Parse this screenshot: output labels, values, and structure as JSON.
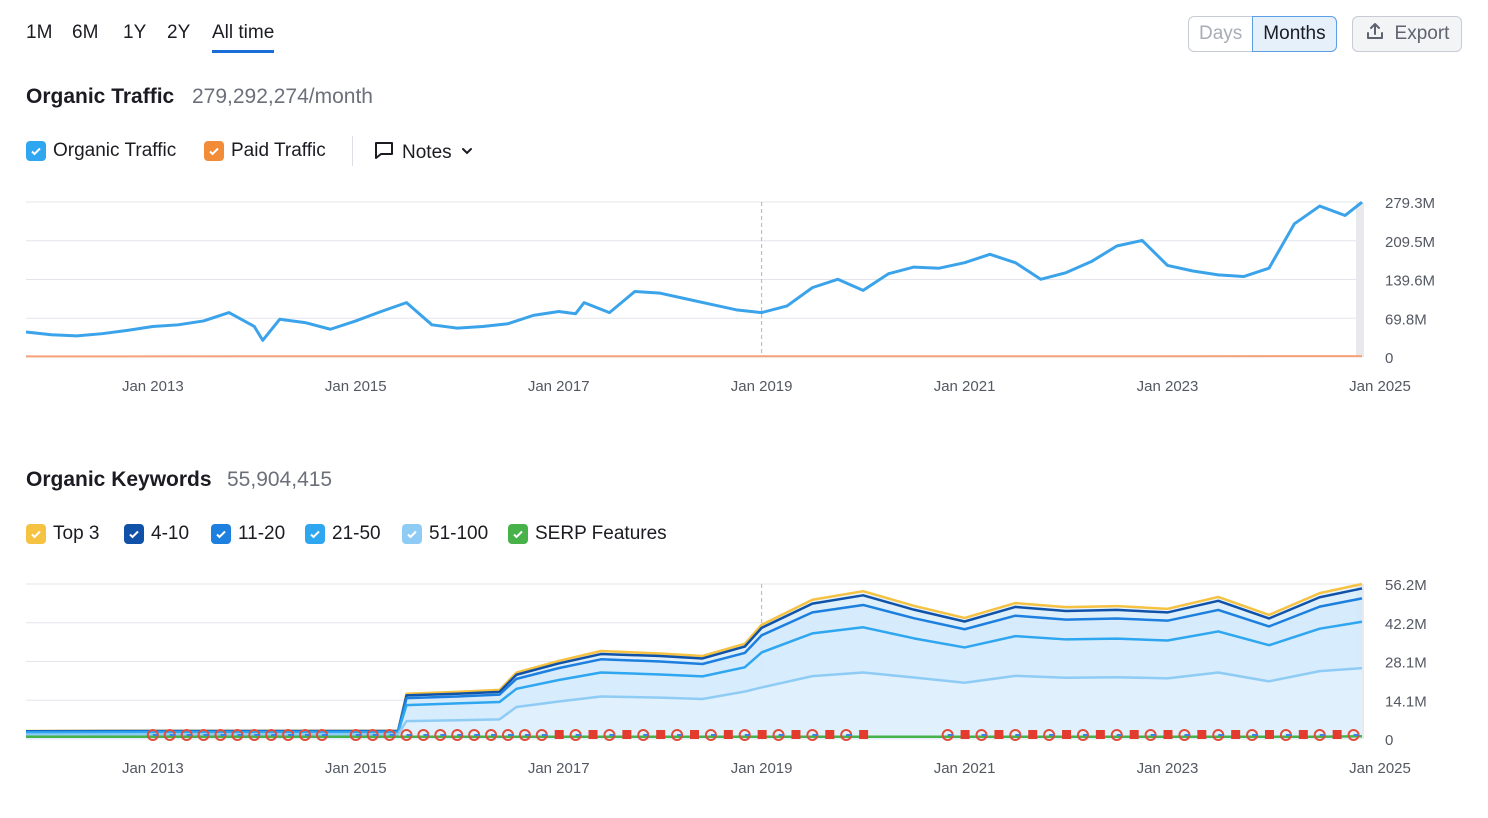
{
  "range_tabs": [
    "1M",
    "6M",
    "1Y",
    "2Y",
    "All time"
  ],
  "active_range": "All time",
  "granularity": {
    "days": "Days",
    "months": "Months",
    "selected": "Months"
  },
  "export_label": "Export",
  "traffic": {
    "title": "Organic Traffic",
    "value": "279,292,274/month",
    "legend": [
      {
        "label": "Organic Traffic",
        "color": "#2ea6f0",
        "checked": true
      },
      {
        "label": "Paid Traffic",
        "color": "#f28c38",
        "checked": true
      }
    ],
    "notes_label": "Notes"
  },
  "keywords": {
    "title": "Organic Keywords",
    "value": "55,904,415",
    "legend": [
      {
        "label": "Top 3",
        "color": "#f5c242",
        "checked": true
      },
      {
        "label": "4-10",
        "color": "#0f52a8",
        "checked": true
      },
      {
        "label": "11-20",
        "color": "#1d7fde",
        "checked": true
      },
      {
        "label": "21-50",
        "color": "#2ea6f0",
        "checked": true
      },
      {
        "label": "51-100",
        "color": "#8fccf5",
        "checked": true
      },
      {
        "label": "SERP Features",
        "color": "#47b24a",
        "checked": true
      }
    ]
  },
  "chart_data": [
    {
      "type": "line",
      "title": "Organic Traffic",
      "x_tick_labels": [
        "Jan 2013",
        "Jan 2015",
        "Jan 2017",
        "Jan 2019",
        "Jan 2021",
        "Jan 2023",
        "Jan 2025"
      ],
      "y_tick_labels": [
        "0",
        "69.8M",
        "139.6M",
        "209.5M",
        "279.3M"
      ],
      "ylim": [
        0,
        279.3
      ],
      "y_unit": "M",
      "x_range": [
        "2011-10",
        "2024-12"
      ],
      "series": [
        {
          "name": "Organic Traffic",
          "color": "#3ba3ea",
          "x": [
            "2011-10",
            "2012-01",
            "2012-04",
            "2012-07",
            "2012-10",
            "2013-01",
            "2013-04",
            "2013-07",
            "2013-10",
            "2014-01",
            "2014-02",
            "2014-04",
            "2014-07",
            "2014-10",
            "2015-01",
            "2015-04",
            "2015-07",
            "2015-10",
            "2016-01",
            "2016-04",
            "2016-07",
            "2016-10",
            "2017-01",
            "2017-03",
            "2017-04",
            "2017-07",
            "2017-10",
            "2018-01",
            "2018-04",
            "2018-07",
            "2018-10",
            "2019-01",
            "2019-04",
            "2019-07",
            "2019-10",
            "2020-01",
            "2020-04",
            "2020-07",
            "2020-10",
            "2021-01",
            "2021-04",
            "2021-07",
            "2021-10",
            "2022-01",
            "2022-04",
            "2022-07",
            "2022-10",
            "2023-01",
            "2023-04",
            "2023-07",
            "2023-10",
            "2024-01",
            "2024-04",
            "2024-07",
            "2024-10",
            "2024-12"
          ],
          "values": [
            45,
            40,
            38,
            42,
            48,
            55,
            58,
            65,
            80,
            55,
            30,
            68,
            62,
            50,
            65,
            82,
            98,
            58,
            52,
            55,
            60,
            75,
            82,
            78,
            98,
            80,
            118,
            115,
            105,
            95,
            85,
            80,
            92,
            125,
            140,
            120,
            150,
            162,
            160,
            170,
            185,
            170,
            140,
            152,
            172,
            200,
            210,
            165,
            155,
            148,
            145,
            160,
            240,
            272,
            255,
            279
          ]
        },
        {
          "name": "Paid Traffic",
          "color": "#f5a27a",
          "x": [
            "2011-10",
            "2024-12"
          ],
          "values": [
            1.2,
            1.5
          ]
        }
      ]
    },
    {
      "type": "area",
      "title": "Organic Keywords",
      "x_tick_labels": [
        "Jan 2013",
        "Jan 2015",
        "Jan 2017",
        "Jan 2019",
        "Jan 2021",
        "Jan 2023",
        "Jan 2025"
      ],
      "y_tick_labels": [
        "0",
        "14.1M",
        "28.1M",
        "42.2M",
        "56.2M"
      ],
      "ylim": [
        0,
        56.2
      ],
      "y_unit": "M",
      "stacked": true,
      "x": [
        "2011-10",
        "2013-01",
        "2014-01",
        "2015-06",
        "2015-07",
        "2016-01",
        "2016-06",
        "2016-08",
        "2017-01",
        "2017-06",
        "2018-01",
        "2018-06",
        "2018-11",
        "2019-01",
        "2019-07",
        "2020-01",
        "2020-07",
        "2021-01",
        "2021-07",
        "2022-01",
        "2022-07",
        "2023-01",
        "2023-07",
        "2024-01",
        "2024-07",
        "2024-12"
      ],
      "series": [
        {
          "name": "Top 3",
          "color": "#f5c242",
          "values": [
            2.9,
            3.0,
            3.0,
            3.0,
            16.4,
            17.1,
            17.8,
            24.1,
            28.3,
            31.9,
            31.0,
            30.1,
            34.5,
            41.4,
            50.5,
            53.6,
            48.3,
            43.9,
            49.3,
            47.8,
            48.2,
            47.2,
            51.5,
            45.0,
            52.9,
            56.2
          ]
        },
        {
          "name": "4-10",
          "color": "#0f52a8",
          "values": [
            2.8,
            2.9,
            2.9,
            2.9,
            15.8,
            16.4,
            17.1,
            23.3,
            27.4,
            30.8,
            30.1,
            29.2,
            33.5,
            40.3,
            49.1,
            52.1,
            46.9,
            42.6,
            47.9,
            46.4,
            46.8,
            45.9,
            50.1,
            43.7,
            51.4,
            54.6
          ]
        },
        {
          "name": "11-20",
          "color": "#1d7fde",
          "values": [
            2.6,
            2.7,
            2.7,
            2.7,
            14.8,
            15.4,
            16.1,
            21.8,
            25.7,
            28.9,
            28.1,
            27.2,
            31.2,
            37.6,
            45.9,
            48.6,
            43.8,
            39.8,
            44.7,
            43.3,
            43.7,
            42.9,
            46.8,
            40.8,
            48.0,
            51.0
          ]
        },
        {
          "name": "21-50",
          "color": "#2ea6f0",
          "values": [
            2.3,
            2.4,
            2.4,
            2.4,
            12.3,
            12.9,
            13.4,
            18.2,
            21.4,
            24.1,
            23.4,
            22.7,
            26.0,
            31.4,
            38.3,
            40.5,
            36.5,
            33.2,
            37.3,
            36.1,
            36.4,
            35.7,
            39.0,
            34.0,
            40.0,
            42.5
          ]
        },
        {
          "name": "51-100",
          "color": "#8fccf5",
          "values": [
            1.6,
            1.7,
            1.7,
            1.7,
            6.5,
            6.8,
            7.1,
            11.6,
            13.6,
            15.4,
            15.0,
            14.5,
            17.2,
            18.7,
            22.8,
            24.1,
            22.3,
            20.4,
            22.9,
            22.2,
            22.4,
            22.0,
            24.1,
            20.9,
            24.6,
            25.7
          ]
        },
        {
          "name": "SERP Features",
          "color": "#47b24a",
          "values": [
            0.8,
            0.8,
            0.8,
            0.8,
            0.8,
            0.8,
            0.8,
            0.8,
            0.8,
            0.8,
            0.8,
            0.8,
            0.8,
            0.8,
            0.8,
            0.8,
            0.8,
            0.8,
            0.8,
            0.8,
            0.8,
            0.8,
            0.8,
            0.8,
            0.8,
            1.0
          ]
        }
      ]
    }
  ]
}
